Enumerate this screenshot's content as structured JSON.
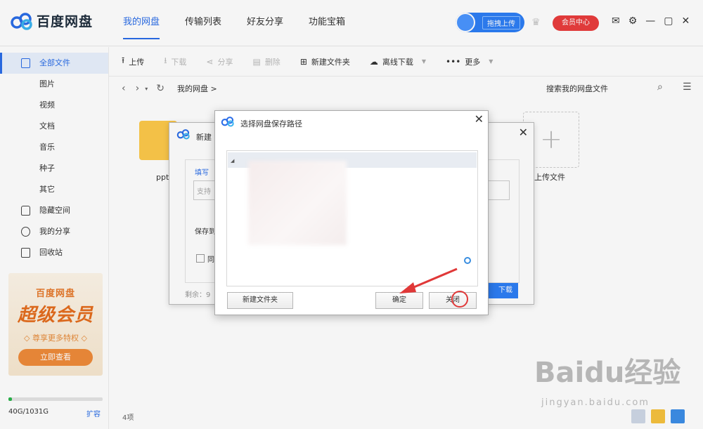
{
  "app": {
    "title": "百度网盘"
  },
  "nav": {
    "tabs": [
      "我的网盘",
      "传输列表",
      "好友分享",
      "功能宝箱"
    ],
    "active_index": 0
  },
  "header": {
    "upload_label": "拖拽上传",
    "vip_label": "会员中心"
  },
  "sidebar": {
    "items": [
      {
        "label": "全部文件",
        "active": true
      },
      {
        "label": "图片"
      },
      {
        "label": "视频"
      },
      {
        "label": "文档"
      },
      {
        "label": "音乐"
      },
      {
        "label": "种子"
      },
      {
        "label": "其它"
      },
      {
        "label": "隐藏空间"
      },
      {
        "label": "我的分享"
      },
      {
        "label": "回收站"
      }
    ],
    "promo": {
      "title": "百度网盘",
      "subtitle": "超级会员",
      "desc": "◇ 尊享更多特权 ◇",
      "button": "立即查看"
    },
    "storage": {
      "used_label": "40G/1031G",
      "fraction": 0.039,
      "expand_label": "扩容"
    }
  },
  "toolbar": {
    "upload": "上传",
    "download": "下载",
    "share": "分享",
    "delete": "删除",
    "new_folder": "新建文件夹",
    "offline": "离线下载",
    "more": "更多"
  },
  "pathbar": {
    "crumb": "我的网盘",
    "search_placeholder": "搜索我的网盘文件"
  },
  "content": {
    "folder_label": "ppt",
    "upload_tile_label": "上传文件",
    "item_count": "4项"
  },
  "dialog_back": {
    "title": "新建",
    "field_label": "填写",
    "field_placeholder": "支持",
    "save_label": "保存到",
    "checkbox_label": "同",
    "remaining": "剩余：9",
    "download_button": "下载"
  },
  "dialog_front": {
    "title": "选择网盘保存路径",
    "buttons": {
      "new_folder": "新建文件夹",
      "ok": "确定",
      "close": "关闭"
    }
  },
  "watermark": {
    "main": "Baidu经验",
    "sub": "jingyan.baidu.com"
  },
  "colors": {
    "accent": "#2a6de8",
    "vip": "#ea3d3d",
    "folder": "#fdc94a",
    "arrow": "#e03838"
  }
}
